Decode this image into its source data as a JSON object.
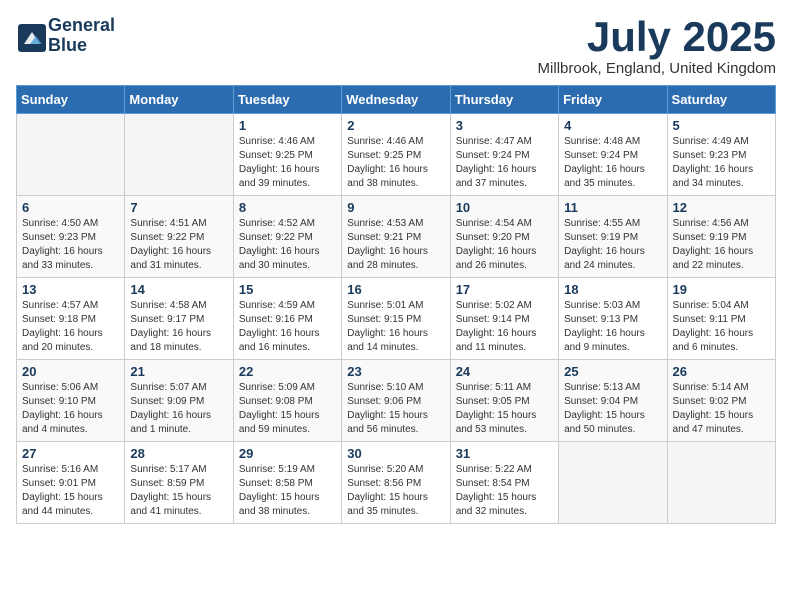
{
  "header": {
    "logo_line1": "General",
    "logo_line2": "Blue",
    "title": "July 2025",
    "location": "Millbrook, England, United Kingdom"
  },
  "days_of_week": [
    "Sunday",
    "Monday",
    "Tuesday",
    "Wednesday",
    "Thursday",
    "Friday",
    "Saturday"
  ],
  "weeks": [
    [
      {
        "day": "",
        "sunrise": "",
        "sunset": "",
        "daylight": ""
      },
      {
        "day": "",
        "sunrise": "",
        "sunset": "",
        "daylight": ""
      },
      {
        "day": "1",
        "sunrise": "Sunrise: 4:46 AM",
        "sunset": "Sunset: 9:25 PM",
        "daylight": "Daylight: 16 hours and 39 minutes."
      },
      {
        "day": "2",
        "sunrise": "Sunrise: 4:46 AM",
        "sunset": "Sunset: 9:25 PM",
        "daylight": "Daylight: 16 hours and 38 minutes."
      },
      {
        "day": "3",
        "sunrise": "Sunrise: 4:47 AM",
        "sunset": "Sunset: 9:24 PM",
        "daylight": "Daylight: 16 hours and 37 minutes."
      },
      {
        "day": "4",
        "sunrise": "Sunrise: 4:48 AM",
        "sunset": "Sunset: 9:24 PM",
        "daylight": "Daylight: 16 hours and 35 minutes."
      },
      {
        "day": "5",
        "sunrise": "Sunrise: 4:49 AM",
        "sunset": "Sunset: 9:23 PM",
        "daylight": "Daylight: 16 hours and 34 minutes."
      }
    ],
    [
      {
        "day": "6",
        "sunrise": "Sunrise: 4:50 AM",
        "sunset": "Sunset: 9:23 PM",
        "daylight": "Daylight: 16 hours and 33 minutes."
      },
      {
        "day": "7",
        "sunrise": "Sunrise: 4:51 AM",
        "sunset": "Sunset: 9:22 PM",
        "daylight": "Daylight: 16 hours and 31 minutes."
      },
      {
        "day": "8",
        "sunrise": "Sunrise: 4:52 AM",
        "sunset": "Sunset: 9:22 PM",
        "daylight": "Daylight: 16 hours and 30 minutes."
      },
      {
        "day": "9",
        "sunrise": "Sunrise: 4:53 AM",
        "sunset": "Sunset: 9:21 PM",
        "daylight": "Daylight: 16 hours and 28 minutes."
      },
      {
        "day": "10",
        "sunrise": "Sunrise: 4:54 AM",
        "sunset": "Sunset: 9:20 PM",
        "daylight": "Daylight: 16 hours and 26 minutes."
      },
      {
        "day": "11",
        "sunrise": "Sunrise: 4:55 AM",
        "sunset": "Sunset: 9:19 PM",
        "daylight": "Daylight: 16 hours and 24 minutes."
      },
      {
        "day": "12",
        "sunrise": "Sunrise: 4:56 AM",
        "sunset": "Sunset: 9:19 PM",
        "daylight": "Daylight: 16 hours and 22 minutes."
      }
    ],
    [
      {
        "day": "13",
        "sunrise": "Sunrise: 4:57 AM",
        "sunset": "Sunset: 9:18 PM",
        "daylight": "Daylight: 16 hours and 20 minutes."
      },
      {
        "day": "14",
        "sunrise": "Sunrise: 4:58 AM",
        "sunset": "Sunset: 9:17 PM",
        "daylight": "Daylight: 16 hours and 18 minutes."
      },
      {
        "day": "15",
        "sunrise": "Sunrise: 4:59 AM",
        "sunset": "Sunset: 9:16 PM",
        "daylight": "Daylight: 16 hours and 16 minutes."
      },
      {
        "day": "16",
        "sunrise": "Sunrise: 5:01 AM",
        "sunset": "Sunset: 9:15 PM",
        "daylight": "Daylight: 16 hours and 14 minutes."
      },
      {
        "day": "17",
        "sunrise": "Sunrise: 5:02 AM",
        "sunset": "Sunset: 9:14 PM",
        "daylight": "Daylight: 16 hours and 11 minutes."
      },
      {
        "day": "18",
        "sunrise": "Sunrise: 5:03 AM",
        "sunset": "Sunset: 9:13 PM",
        "daylight": "Daylight: 16 hours and 9 minutes."
      },
      {
        "day": "19",
        "sunrise": "Sunrise: 5:04 AM",
        "sunset": "Sunset: 9:11 PM",
        "daylight": "Daylight: 16 hours and 6 minutes."
      }
    ],
    [
      {
        "day": "20",
        "sunrise": "Sunrise: 5:06 AM",
        "sunset": "Sunset: 9:10 PM",
        "daylight": "Daylight: 16 hours and 4 minutes."
      },
      {
        "day": "21",
        "sunrise": "Sunrise: 5:07 AM",
        "sunset": "Sunset: 9:09 PM",
        "daylight": "Daylight: 16 hours and 1 minute."
      },
      {
        "day": "22",
        "sunrise": "Sunrise: 5:09 AM",
        "sunset": "Sunset: 9:08 PM",
        "daylight": "Daylight: 15 hours and 59 minutes."
      },
      {
        "day": "23",
        "sunrise": "Sunrise: 5:10 AM",
        "sunset": "Sunset: 9:06 PM",
        "daylight": "Daylight: 15 hours and 56 minutes."
      },
      {
        "day": "24",
        "sunrise": "Sunrise: 5:11 AM",
        "sunset": "Sunset: 9:05 PM",
        "daylight": "Daylight: 15 hours and 53 minutes."
      },
      {
        "day": "25",
        "sunrise": "Sunrise: 5:13 AM",
        "sunset": "Sunset: 9:04 PM",
        "daylight": "Daylight: 15 hours and 50 minutes."
      },
      {
        "day": "26",
        "sunrise": "Sunrise: 5:14 AM",
        "sunset": "Sunset: 9:02 PM",
        "daylight": "Daylight: 15 hours and 47 minutes."
      }
    ],
    [
      {
        "day": "27",
        "sunrise": "Sunrise: 5:16 AM",
        "sunset": "Sunset: 9:01 PM",
        "daylight": "Daylight: 15 hours and 44 minutes."
      },
      {
        "day": "28",
        "sunrise": "Sunrise: 5:17 AM",
        "sunset": "Sunset: 8:59 PM",
        "daylight": "Daylight: 15 hours and 41 minutes."
      },
      {
        "day": "29",
        "sunrise": "Sunrise: 5:19 AM",
        "sunset": "Sunset: 8:58 PM",
        "daylight": "Daylight: 15 hours and 38 minutes."
      },
      {
        "day": "30",
        "sunrise": "Sunrise: 5:20 AM",
        "sunset": "Sunset: 8:56 PM",
        "daylight": "Daylight: 15 hours and 35 minutes."
      },
      {
        "day": "31",
        "sunrise": "Sunrise: 5:22 AM",
        "sunset": "Sunset: 8:54 PM",
        "daylight": "Daylight: 15 hours and 32 minutes."
      },
      {
        "day": "",
        "sunrise": "",
        "sunset": "",
        "daylight": ""
      },
      {
        "day": "",
        "sunrise": "",
        "sunset": "",
        "daylight": ""
      }
    ]
  ],
  "colors": {
    "header_bg": "#2b6cb0",
    "title_color": "#1a3a5c"
  }
}
